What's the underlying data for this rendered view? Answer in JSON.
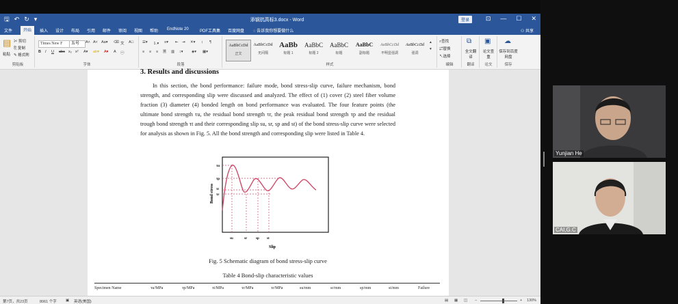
{
  "window": {
    "title": "添钢抗高标3.docx - Word",
    "signin": "登录",
    "controls": [
      "⊡",
      "—",
      "☐",
      "✕"
    ]
  },
  "qat": [
    "🖫",
    "↶",
    "↻",
    "▾"
  ],
  "tabs": [
    "文件",
    "开始",
    "插入",
    "设计",
    "布局",
    "引用",
    "邮件",
    "审阅",
    "视图",
    "帮助",
    "EndNote 20",
    "PDF工具集",
    "百度网盘",
    "告诉我你想要做什么"
  ],
  "active_tab": "开始",
  "share": "共享",
  "ribbon": {
    "clipboard": {
      "paste": "粘贴",
      "cut": "剪切",
      "copy": "复制",
      "format_painter": "格式刷",
      "label": "剪贴板"
    },
    "font": {
      "name": "Times New F",
      "size": "五号",
      "label": "字体"
    },
    "paragraph": {
      "label": "段落"
    },
    "styles": {
      "label": "样式",
      "tiles": [
        {
          "sample": "AaBbCcDd",
          "name": "正文"
        },
        {
          "sample": "AaBbCcDd",
          "name": "无间隔"
        },
        {
          "sample": "AaBb",
          "name": "标题 1"
        },
        {
          "sample": "AaBbC",
          "name": "标题 2"
        },
        {
          "sample": "AaBbC",
          "name": "标题"
        },
        {
          "sample": "AaBbC",
          "name": "副标题"
        },
        {
          "sample": "AaBbCcDd",
          "name": "不明显强调"
        },
        {
          "sample": "AaBbCcDd",
          "name": "强调"
        }
      ]
    },
    "editing": {
      "find": "查找",
      "replace": "替换",
      "select": "选择",
      "label": "编辑"
    },
    "translate": {
      "full": "全文翻译",
      "label": "翻译"
    },
    "paper": {
      "check": "论文查重",
      "label": "论文"
    },
    "save": {
      "baidu": "保存到百度网盘",
      "label": "保存"
    }
  },
  "document": {
    "heading": "3. Results and discussions",
    "paragraph": "In this section, the bond performance: failure mode, bond stress-slip curve, failure mechanism, bond strength, and corresponding slip were discussed and analyzed. The effect of (1) cover (2) steel fiber volume fraction (3) diameter (4) bonded length on bond performance was evaluated. The four feature points (the ultimate bond strength τu, the residual bond strength τr, the peak residual bond strength τp and the residual trough bond strength τt and their corresponding slip su, sr, sp and st) of the bond stress-slip curve were selected for analysis as shown in Fig. 5. All the bond strength and corresponding slip were listed in Table 4.",
    "fig_caption": "Fig. 5 Schematic diagram of bond stress-slip curve",
    "table_caption": "Table 4 Bond-slip characteristic values",
    "figure": {
      "ylabel": "Bond stress",
      "xlabel": "Slip",
      "y_ticks": [
        "τu",
        "τp",
        "τt",
        "τr"
      ],
      "x_ticks": [
        "su",
        "sr",
        "sp",
        "st"
      ],
      "curve_color": "#d04a6a"
    },
    "table_headers": [
      "Specimen Name",
      "τu/MPa",
      "τp/MPa",
      "τt/MPa",
      "τr/MPa",
      "τr/MPa",
      "su/mm",
      "sr/mm",
      "sp/mm",
      "st/mm",
      "Failure"
    ]
  },
  "status": {
    "page": "第7页，共23页",
    "words": "8061 个字",
    "lang": "英语(美国)",
    "zoom": "130%"
  },
  "participants": [
    {
      "name": "Yunjian He"
    },
    {
      "name": "CAI,G.C"
    }
  ]
}
